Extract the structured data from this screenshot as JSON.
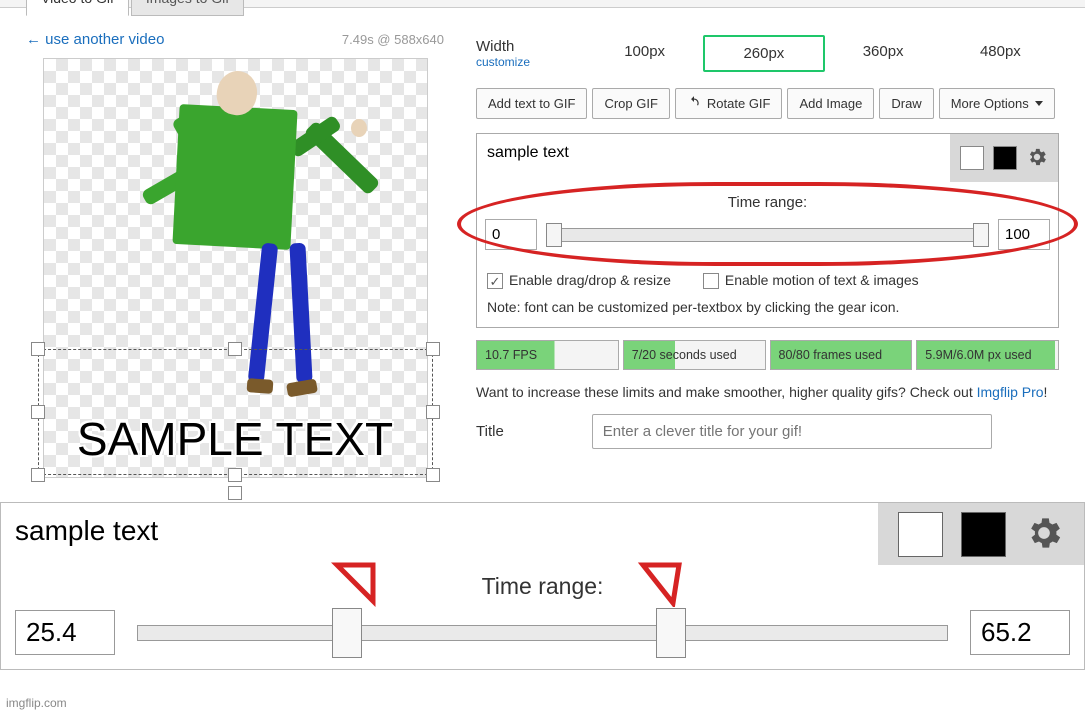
{
  "tabs": {
    "video": "Video to Gif",
    "images": "Images to Gif"
  },
  "use_another": "← use another video",
  "video_meta": "7.49s @ 588x640",
  "sample_overlay": "SAMPLE TEXT",
  "width": {
    "label": "Width",
    "customize": "customize",
    "opts": [
      "100px",
      "260px",
      "360px",
      "480px"
    ],
    "selected": "260px"
  },
  "buttons": {
    "add_text": "Add text to GIF",
    "crop": "Crop GIF",
    "rotate": "Rotate GIF",
    "add_image": "Add Image",
    "draw": "Draw",
    "more": "More Options"
  },
  "text_input": "sample text",
  "time_range": {
    "label": "Time range:",
    "start": "0",
    "end": "100"
  },
  "options": {
    "dragdrop": "Enable drag/drop & resize",
    "dragdrop_checked": true,
    "motion": "Enable motion of text & images",
    "motion_checked": false
  },
  "note": "Note: font can be customized per-textbox by clicking the gear icon.",
  "stats": {
    "fps": "10.7 FPS",
    "seconds": "7/20 seconds used",
    "frames": "80/80 frames used",
    "px": "5.9M/6.0M px used"
  },
  "pro_note_pre": "Want to increase these limits and make smoother, higher quality gifs? Check out ",
  "pro_note_link": "Imgflip Pro",
  "pro_note_post": "!",
  "title": {
    "label": "Title",
    "placeholder": "Enter a clever title for your gif!"
  },
  "zoom": {
    "text": "sample text",
    "time_label": "Time range:",
    "start": "25.4",
    "end": "65.2"
  },
  "watermark": "imgflip.com"
}
